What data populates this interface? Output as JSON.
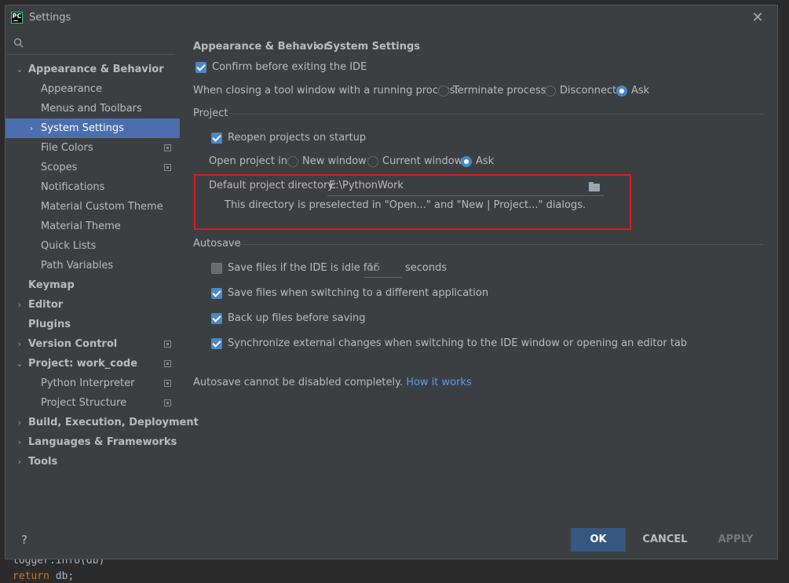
{
  "window": {
    "title": "Settings",
    "app_icon_text": "PC"
  },
  "editor": {
    "line1": "logger.info(db)",
    "line2_kw": "return",
    "line2_rest": " db;"
  },
  "sidebar": {
    "search_placeholder": "",
    "items": [
      {
        "label": "Appearance & Behavior"
      },
      {
        "label": "Appearance"
      },
      {
        "label": "Menus and Toolbars"
      },
      {
        "label": "System Settings"
      },
      {
        "label": "File Colors"
      },
      {
        "label": "Scopes"
      },
      {
        "label": "Notifications"
      },
      {
        "label": "Material Custom Theme"
      },
      {
        "label": "Material Theme"
      },
      {
        "label": "Quick Lists"
      },
      {
        "label": "Path Variables"
      },
      {
        "label": "Keymap"
      },
      {
        "label": "Editor"
      },
      {
        "label": "Plugins"
      },
      {
        "label": "Version Control"
      },
      {
        "label": "Project: work_code"
      },
      {
        "label": "Python Interpreter"
      },
      {
        "label": "Project Structure"
      },
      {
        "label": "Build, Execution, Deployment"
      },
      {
        "label": "Languages & Frameworks"
      },
      {
        "label": "Tools"
      }
    ]
  },
  "breadcrumb": {
    "parent": "Appearance & Behavior",
    "separator": "›",
    "current": "System Settings"
  },
  "general": {
    "confirm_exit": "Confirm before exiting the IDE",
    "closing_label": "When closing a tool window with a running process:",
    "closing_options": [
      "Terminate process",
      "Disconnect",
      "Ask"
    ]
  },
  "project": {
    "header": "Project",
    "reopen": "Reopen projects on startup",
    "open_in_label": "Open project in",
    "open_in_options": [
      "New window",
      "Current window",
      "Ask"
    ],
    "default_dir_label": "Default project directory:",
    "default_dir_value": "E:\\PythonWork",
    "default_dir_hint": "This directory is preselected in \"Open...\" and \"New | Project...\" dialogs."
  },
  "autosave": {
    "header": "Autosave",
    "idle_label": "Save files if the IDE is idle for",
    "idle_value": "15",
    "idle_unit": "seconds",
    "switching": "Save files when switching to a different application",
    "backup": "Back up files before saving",
    "sync": "Synchronize external changes when switching to the IDE window or opening an editor tab",
    "note": "Autosave cannot be disabled completely.",
    "link": "How it works"
  },
  "footer": {
    "help": "?",
    "ok": "OK",
    "cancel": "CANCEL",
    "apply": "APPLY"
  },
  "colors": {
    "selection": "#4b6eaf",
    "checkbox": "#4a88c7",
    "highlight": "#e01b24",
    "ok_button": "#365880",
    "link": "#589df6"
  }
}
